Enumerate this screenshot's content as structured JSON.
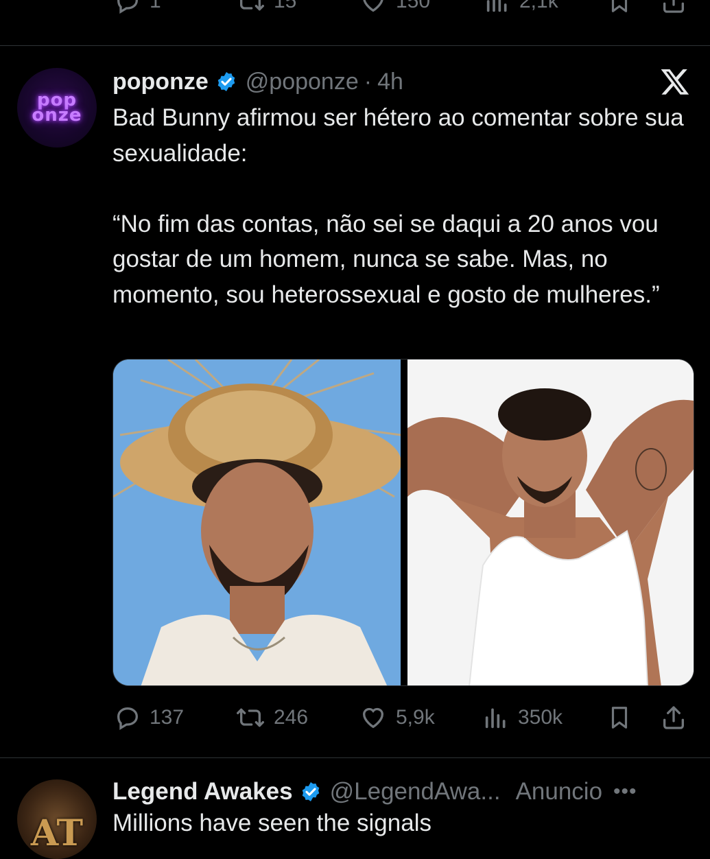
{
  "previous_tweet": {
    "actions": {
      "replies": "1",
      "retweets": "15",
      "likes": "150",
      "views": "2,1k"
    }
  },
  "tweet": {
    "display_name": "poponze",
    "handle": "@poponze",
    "separator": "·",
    "time": "4h",
    "avatar_text_1": "pop",
    "avatar_text_2": "onze",
    "text": "Bad Bunny afirmou ser hétero ao comentar sobre sua sexualidade:\n\n“No fim das contas, não sei se daqui a 20 anos vou gostar de um homem, nunca se sabe. Mas, no momento, sou heterossexual e gosto de mulheres.”",
    "actions": {
      "replies": "137",
      "retweets": "246",
      "likes": "5,9k",
      "views": "350k"
    }
  },
  "ad_tweet": {
    "display_name": "Legend Awakes",
    "handle": "@LegendAwa...",
    "label": "Anuncio",
    "more": "•••",
    "avatar_text": "AT",
    "text": "Millions have seen the signals"
  },
  "colors": {
    "background": "#000000",
    "text_primary": "#e7e9ea",
    "text_secondary": "#71767b",
    "verified": "#1d9bf0",
    "divider": "#2f3336"
  },
  "icons": [
    "reply-icon",
    "retweet-icon",
    "like-icon",
    "views-icon",
    "bookmark-icon",
    "share-icon",
    "verified-icon",
    "x-logo-icon"
  ]
}
